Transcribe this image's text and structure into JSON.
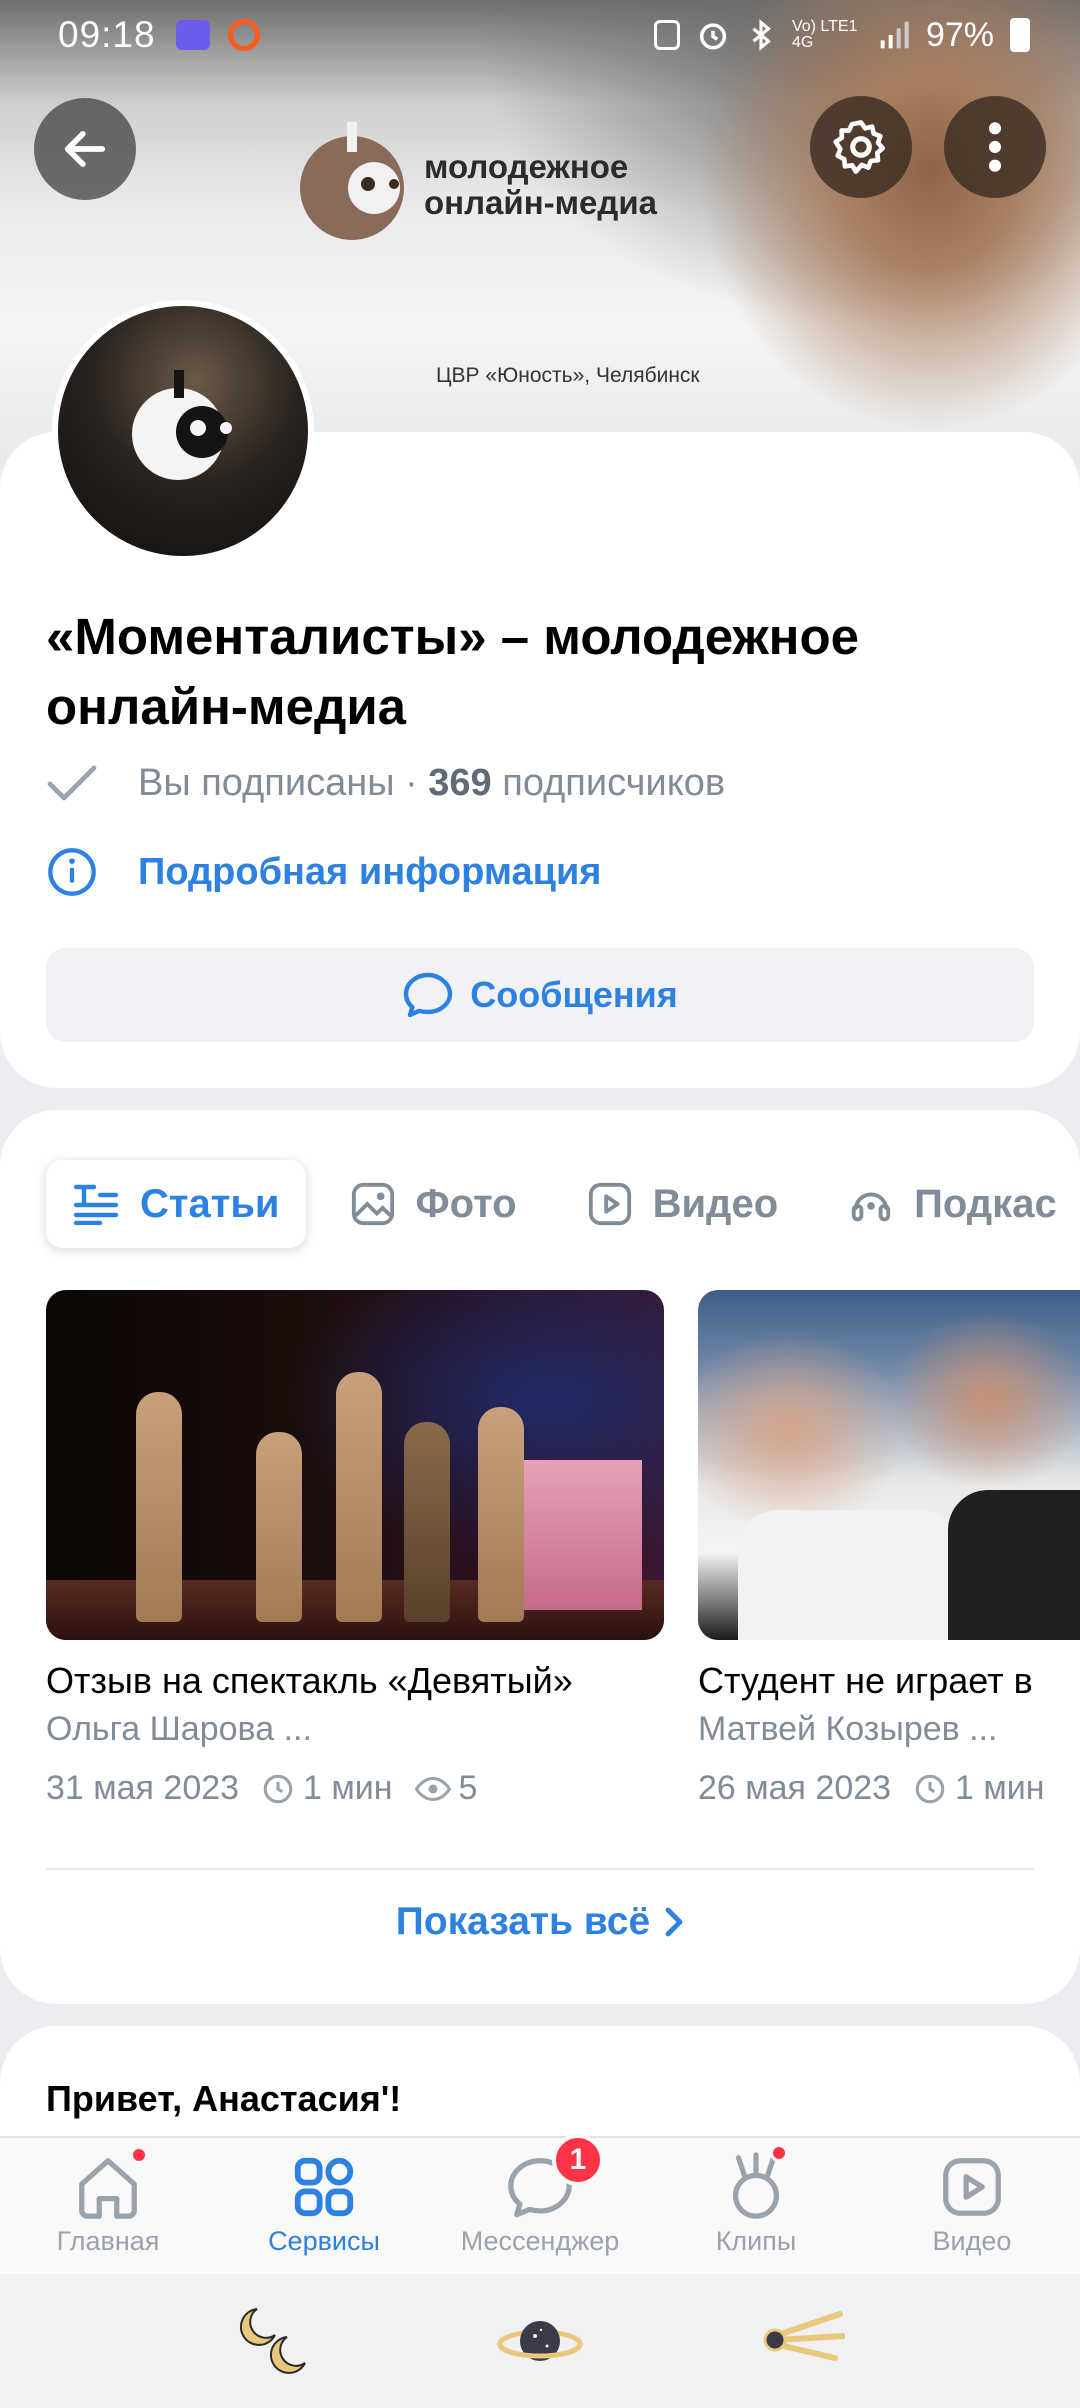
{
  "status_bar": {
    "time": "09:18",
    "network_label": "Vo) LTE1 4G",
    "battery": "97%"
  },
  "cover": {
    "logo_line1": "молодежное",
    "logo_line2": "онлайн-медиа",
    "caption": "ЦВР «Юность», Челябинск"
  },
  "community": {
    "title": "«Моменталисты» – молодежное онлайн-медиа",
    "subscribed_label": "Вы подписаны",
    "separator": "·",
    "subscriber_count": "369",
    "subscribers_word": "подписчиков",
    "details_link": "Подробная информация",
    "messages_button": "Сообщения"
  },
  "tabs": [
    {
      "label": "Статьи",
      "icon": "articles-icon",
      "active": true
    },
    {
      "label": "Фото",
      "icon": "photo-icon",
      "active": false
    },
    {
      "label": "Видео",
      "icon": "video-icon",
      "active": false
    },
    {
      "label": "Подкас",
      "icon": "podcast-icon",
      "active": false
    }
  ],
  "articles": [
    {
      "title": "Отзыв на спектакль «Девятый»",
      "author": "Ольга Шарова ...",
      "date": "31 мая 2023",
      "read_time": "1 мин",
      "views": "5"
    },
    {
      "title": "Студент не играет в",
      "author": "Матвей Козырев ...",
      "date": "26 мая 2023",
      "read_time": "1 мин"
    }
  ],
  "show_all": "Показать всё",
  "greeting": "Привет, Анастасия'!",
  "tabbar": [
    {
      "label": "Главная",
      "icon": "home-icon",
      "dot": true
    },
    {
      "label": "Сервисы",
      "icon": "services-icon",
      "active": true
    },
    {
      "label": "Мессенджер",
      "icon": "messenger-icon",
      "badge": "1"
    },
    {
      "label": "Клипы",
      "icon": "clips-icon",
      "dot": true
    },
    {
      "label": "Видео",
      "icon": "video-icon"
    }
  ],
  "colors": {
    "accent": "#2d81e0",
    "secondary_text": "#818c99",
    "badge": "#ff3347"
  }
}
